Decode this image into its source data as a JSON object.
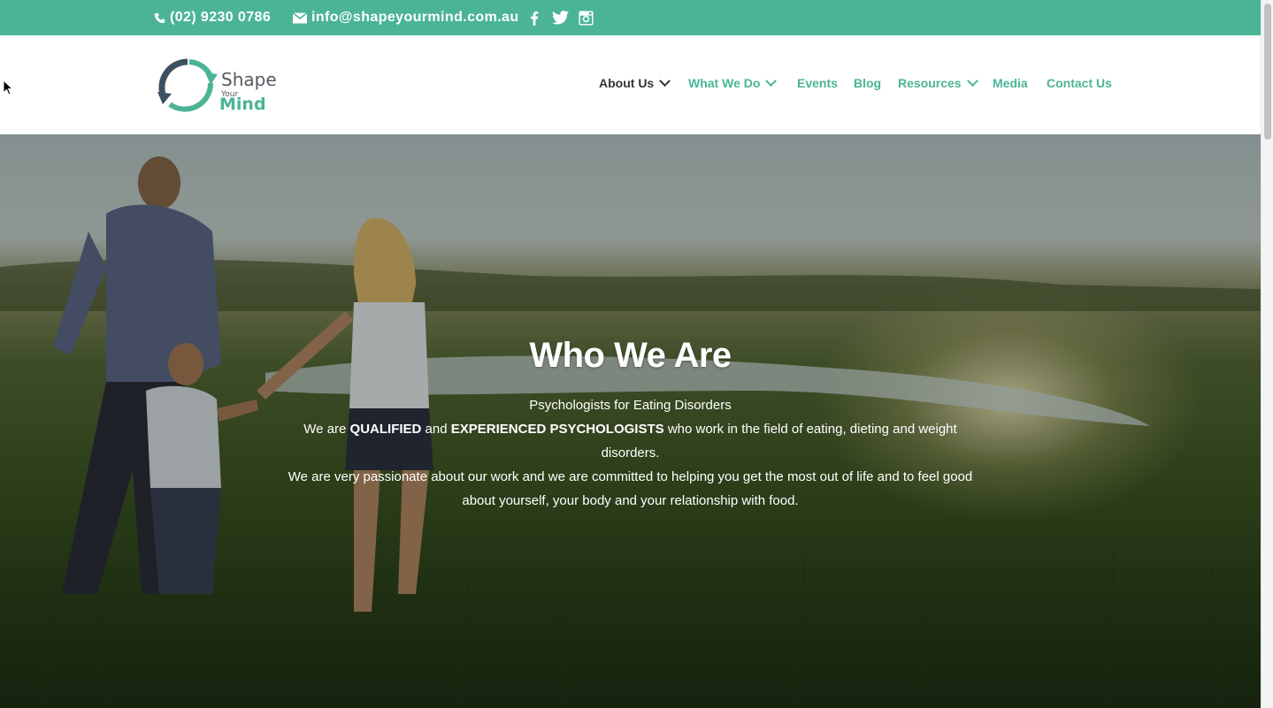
{
  "topbar": {
    "phone": "(02) 9230 0786",
    "email": "info@shapeyourmind.com.au",
    "social": [
      "facebook-icon",
      "twitter-icon",
      "instagram-icon"
    ]
  },
  "logo": {
    "shape": "Shape",
    "your": "Your",
    "mind": "Mind"
  },
  "nav": {
    "about": "About Us",
    "whatwedo": "What We Do",
    "events": "Events",
    "blog": "Blog",
    "resources": "Resources",
    "media": "Media",
    "contact": "Contact Us"
  },
  "hero": {
    "title": "Who We Are",
    "subtitle": "Psychologists for Eating Disorders",
    "p1_a": "We are ",
    "p1_b": "QUALIFIED",
    "p1_c": " and ",
    "p1_d": "EXPERIENCED PSYCHOLOGISTS",
    "p1_e": " who work in the field of eating, dieting and weight disorders.",
    "p2": "We are very passionate about our work and we are committed to helping you get the most out of life and to feel good about yourself, your body and your relationship with food."
  },
  "colors": {
    "accent": "#4bb496",
    "nav_active": "#333333"
  }
}
